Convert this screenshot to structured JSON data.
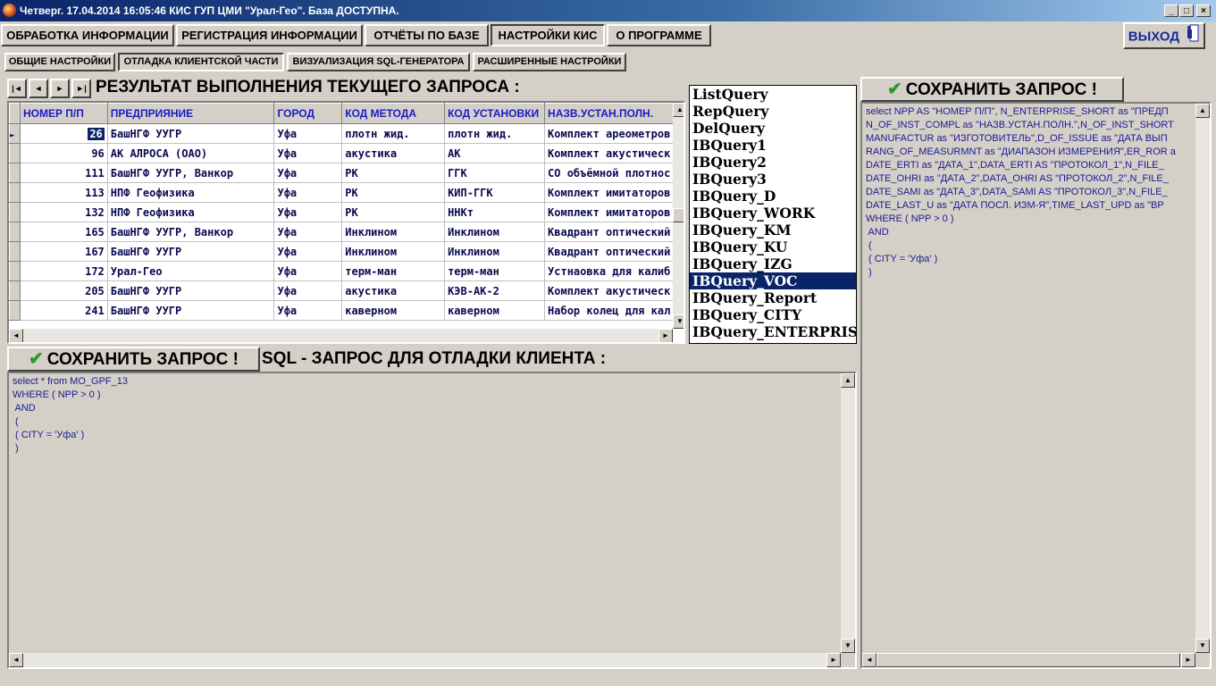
{
  "window": {
    "title": "Четверг. 17.04.2014 16:05:46  КИС ГУП ЦМИ \"Урал-Гео\". База ДОСТУПНА.",
    "controls": [
      "_",
      "□",
      "×"
    ]
  },
  "top_menu": [
    {
      "label": "ОБРАБОТКА ИНФОРМАЦИИ"
    },
    {
      "label": "РЕГИСТРАЦИЯ ИНФОРМАЦИИ"
    },
    {
      "label": "ОТЧЁТЫ ПО БАЗЕ"
    },
    {
      "label": "НАСТРОЙКИ КИС",
      "active": true
    },
    {
      "label": "О ПРОГРАММЕ"
    }
  ],
  "exit_button": {
    "label": "ВЫХОД"
  },
  "sub_tabs": [
    {
      "label": "ОБЩИЕ НАСТРОЙКИ"
    },
    {
      "label": "ОТЛАДКА КЛИЕНТСКОЙ ЧАСТИ",
      "active": true
    },
    {
      "label": "ВИЗУАЛИЗАЦИЯ SQL-ГЕНЕРАТОРА"
    },
    {
      "label": "РАСШИРЕННЫЕ НАСТРОЙКИ"
    }
  ],
  "navigator": [
    "|◄",
    "◄",
    "►",
    "►|"
  ],
  "result_heading": "РЕЗУЛЬТАТ ВЫПОЛНЕНИЯ ТЕКУЩЕГО ЗАПРОСА :",
  "grid": {
    "columns": [
      "НОМЕР П/П",
      "ПРЕДПРИЯНИЕ",
      "ГОРОД",
      "КОД МЕТОДА",
      "КОД УСТАНОВКИ",
      "НАЗВ.УСТАН.ПОЛН."
    ],
    "rows": [
      [
        "26",
        "БашНГФ УУГР",
        "Уфа",
        "плотн жид.",
        "плотн жид.",
        "Комплект ареометров"
      ],
      [
        "96",
        "АК АЛРОСА (ОАО)",
        "Уфа",
        "акустика",
        "АК",
        "Комплект акустическ"
      ],
      [
        "111",
        "БашНГФ УУГР, Ванкор",
        "Уфа",
        "РК",
        "ГГК",
        "СО объёмной плотнос"
      ],
      [
        "113",
        "НПФ Геофизика",
        "Уфа",
        "РК",
        "КИП-ГГК",
        "Комплект имитаторов"
      ],
      [
        "132",
        "НПФ Геофизика",
        "Уфа",
        "РК",
        "ННКт",
        "Комплект имитаторов"
      ],
      [
        "165",
        "БашНГФ УУГР, Ванкор",
        "Уфа",
        "Инклином",
        "Инклином",
        "Квадрант оптический"
      ],
      [
        "167",
        "БашНГФ УУГР",
        "Уфа",
        "Инклином",
        "Инклином",
        "Квадрант оптический"
      ],
      [
        "172",
        "Урал-Гео",
        "Уфа",
        "терм-ман",
        "терм-ман",
        "Устнаовка для калиб"
      ],
      [
        "205",
        "БашНГФ УУГР",
        "Уфа",
        "акустика",
        "КЭВ-АК-2",
        "Комплект акустическ"
      ],
      [
        "241",
        "БашНГФ УУГР",
        "Уфа",
        "каверном",
        "каверном",
        "Набор колец для кал"
      ]
    ],
    "selected_row": 0
  },
  "query_list": {
    "items": [
      "ListQuery",
      "RepQuery",
      "DelQuery",
      "IBQuery1",
      "IBQuery2",
      "IBQuery3",
      "IBQuery_D",
      "IBQuery_WORK",
      "IBQuery_KM",
      "IBQuery_KU",
      "IBQuery_IZG",
      "IBQuery_VOC",
      "IBQuery_Report",
      "IBQuery_CITY",
      "IBQuery_ENTERPRISE"
    ],
    "selected": "IBQuery_VOC"
  },
  "save_button_label": "СОХРАНИТЬ ЗАПРОС !",
  "client_sql_heading": "SQL - ЗАПРОС ДЛЯ ОТЛАДКИ КЛИЕНТА :",
  "client_sql": [
    "select * from MO_GPF_13",
    "WHERE ( NPP > 0 )",
    " AND",
    " (",
    " ( CITY = 'Уфа' )",
    " )"
  ],
  "right_sql": [
    "select NPP AS \"НОМЕР П/П\", N_ENTERPRISE_SHORT as \"ПРЕДП",
    "N_OF_INST_COMPL as \"НАЗВ.УСТАН.ПОЛН.\",N_OF_INST_SHORT",
    "MANUFACTUR as \"ИЗГОТОВИТЕЛЬ\",D_OF_ISSUE as \"ДАТА ВЫП",
    "RANG_OF_MEASURMNT as \"ДИАПАЗОН ИЗМЕРЕНИЯ\",ER_ROR a",
    "DATE_ERTI as \"ДАТА_1\",DATA_ERTI AS \"ПРОТОКОЛ_1\",N_FILE_",
    "DATE_OHRI as \"ДАТА_2\",DATA_OHRI AS \"ПРОТОКОЛ_2\",N_FILE_",
    "DATE_SAMI as \"ДАТА_3\",DATA_SAMI AS \"ПРОТОКОЛ_3\",N_FILE_",
    "DATE_LAST_U as \"ДАТА ПОСЛ. ИЗМ-Я\",TIME_LAST_UPD as \"ВР",
    "WHERE ( NPP > 0 )",
    " AND",
    " (",
    " ( CITY = 'Уфа' )",
    " )"
  ],
  "colors": {
    "accent": "#0a246a",
    "sql_text": "#1a1a90",
    "header_text": "#1a1ac8",
    "check": "#2a9a2a"
  }
}
